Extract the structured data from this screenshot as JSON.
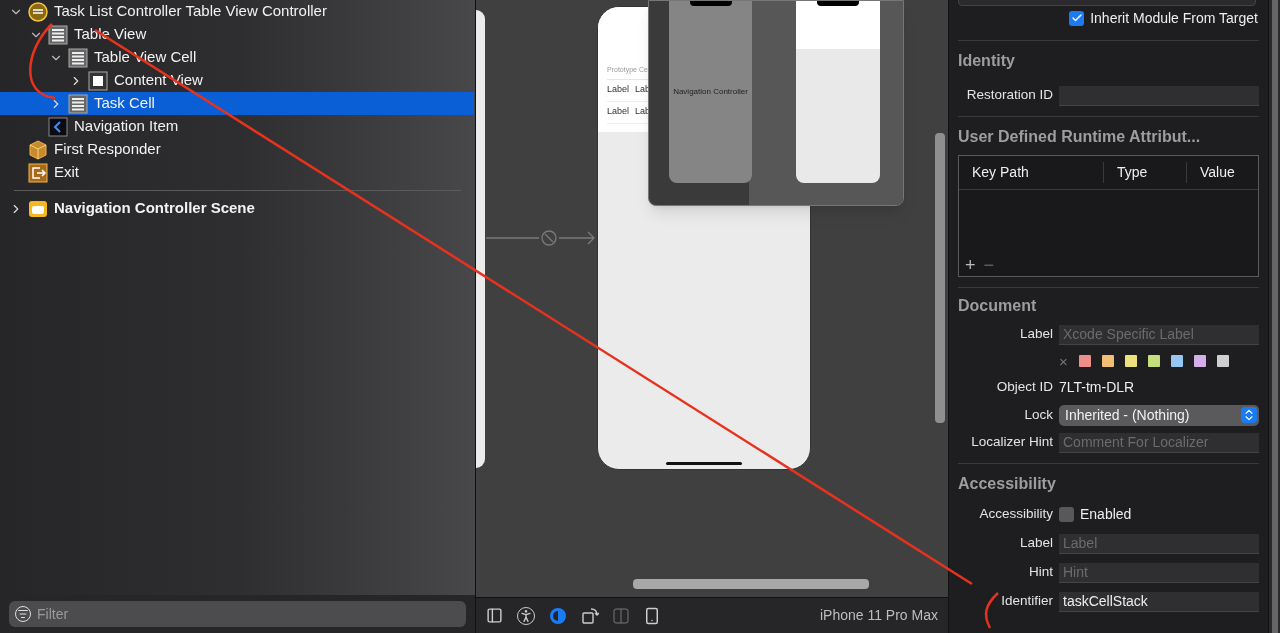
{
  "outline": {
    "items": [
      {
        "label": "Task List Controller Table View Controller",
        "kind": "controller",
        "expanded": true,
        "selected": false,
        "children": [
          {
            "label": "Table View",
            "kind": "table",
            "expanded": true,
            "selected": false,
            "children": [
              {
                "label": "Table View Cell",
                "kind": "table",
                "expanded": true,
                "selected": false,
                "children": [
                  {
                    "label": "Content View",
                    "kind": "view",
                    "expanded": false,
                    "selected": false
                  }
                ]
              },
              {
                "label": "Task Cell",
                "kind": "table",
                "expanded": false,
                "selected": true
              }
            ]
          },
          {
            "label": "Navigation Item",
            "kind": "nav-item",
            "selected": false
          }
        ]
      },
      {
        "label": "First Responder",
        "kind": "responder",
        "selected": false
      },
      {
        "label": "Exit",
        "kind": "exit",
        "selected": false
      }
    ],
    "scenes": [
      {
        "label": "Navigation Controller Scene",
        "kind": "scene",
        "expanded": false,
        "selected": false
      }
    ],
    "filter": {
      "placeholder": "Filter"
    }
  },
  "canvas": {
    "scene": {
      "section_header": "Prototype Ce",
      "rows": [
        [
          "Label",
          "Lab"
        ],
        [
          "Label",
          "Lab"
        ]
      ]
    },
    "minimap": {
      "nav_label": "Navigation Controller"
    },
    "device": "iPhone 11 Pro Max"
  },
  "inspector": {
    "module": {
      "label": "Inherit Module From Target",
      "checked": true
    },
    "identity": {
      "title": "Identity",
      "restoration_id": {
        "label": "Restoration ID"
      }
    },
    "runtime_attributes": {
      "title": "User Defined Runtime Attribut...",
      "columns": [
        "Key Path",
        "Type",
        "Value"
      ],
      "add": "+",
      "remove": "−"
    },
    "document": {
      "title": "Document",
      "label": {
        "label": "Label",
        "placeholder": "Xcode Specific Label"
      },
      "clear": "×",
      "colors": [
        {
          "color": "#ee8e8a"
        },
        {
          "color": "#f2bd74"
        },
        {
          "color": "#ece17a"
        },
        {
          "color": "#c5df7c"
        },
        {
          "color": "#96c6f3"
        },
        {
          "color": "#d3aeea"
        },
        {
          "color": "#cfcfcf"
        }
      ],
      "object_id": {
        "label": "Object ID",
        "value": "7LT-tm-DLR"
      },
      "lock": {
        "label": "Lock",
        "value": "Inherited - (Nothing)"
      },
      "localizer_hint": {
        "label": "Localizer Hint",
        "placeholder": "Comment For Localizer"
      }
    },
    "accessibility": {
      "title": "Accessibility",
      "enabled": {
        "label": "Accessibility",
        "text": "Enabled",
        "checked": false
      },
      "fields": [
        {
          "label": "Label",
          "placeholder": "Label"
        },
        {
          "label": "Hint",
          "placeholder": "Hint"
        },
        {
          "label": "Identifier",
          "value": "taskCellStack"
        }
      ]
    }
  }
}
